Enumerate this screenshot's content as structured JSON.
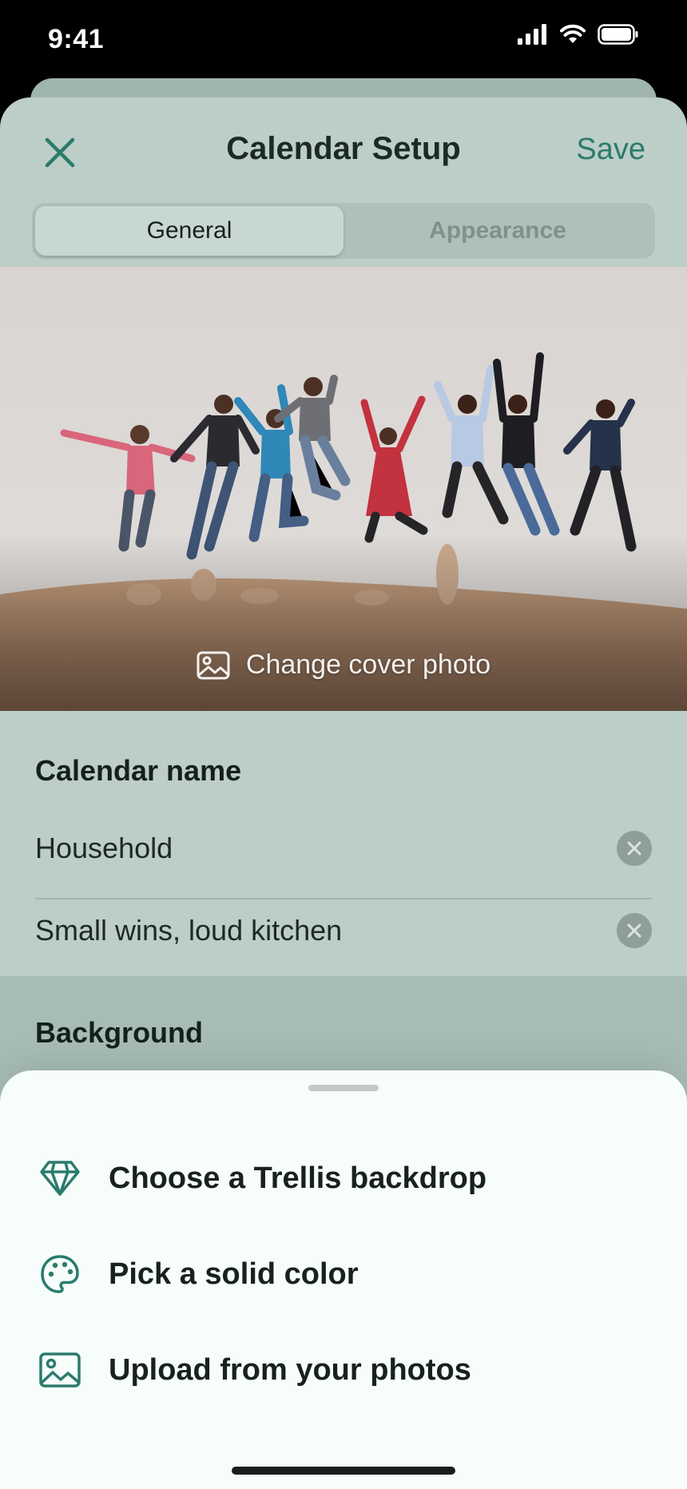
{
  "status_bar": {
    "time": "9:41"
  },
  "nav": {
    "title": "Calendar Setup",
    "save_label": "Save"
  },
  "tabs": [
    {
      "label": "General",
      "active": true
    },
    {
      "label": "Appearance",
      "active": false
    }
  ],
  "cover": {
    "change_label": "Change cover photo"
  },
  "calendar_name": {
    "heading": "Calendar name",
    "name_value": "Household",
    "tagline_value": "Small wins, loud kitchen"
  },
  "background": {
    "heading": "Background"
  },
  "action_sheet": {
    "options": [
      {
        "label": "Choose a Trellis backdrop",
        "icon": "diamond-icon"
      },
      {
        "label": "Pick a solid color",
        "icon": "palette-icon"
      },
      {
        "label": "Upload from your photos",
        "icon": "image-icon"
      }
    ]
  },
  "colors": {
    "accent": "#2B7B6C",
    "sheet_bg": "#BCCEC7",
    "action_sheet_bg": "#F6FDFB"
  }
}
